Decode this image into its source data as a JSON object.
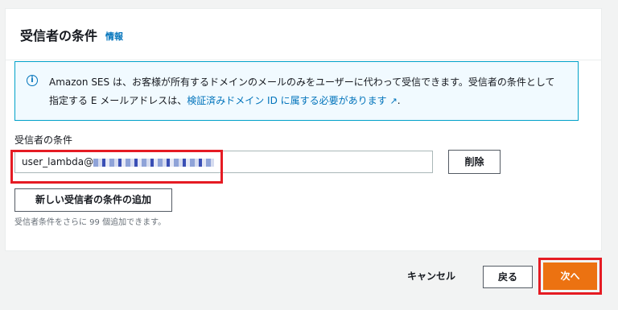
{
  "panel": {
    "title": "受信者の条件",
    "info_link": "情報"
  },
  "alert": {
    "icon": "info-icon",
    "text": "Amazon SES は、お客様が所有するドメインのメールのみをユーザーに代わって受信できます。受信者の条件として指定する E メールアドレスは、",
    "link_text": "検証済みドメイン ID に属する必要があります",
    "suffix": "."
  },
  "condition": {
    "label": "受信者の条件",
    "value": "user_lambda@",
    "delete_label": "削除",
    "add_label": "新しい受信者の条件の追加",
    "hint": "受信者条件をさらに 99 個追加できます。"
  },
  "footer": {
    "cancel_label": "キャンセル",
    "back_label": "戻る",
    "next_label": "次へ"
  },
  "colors": {
    "accent": "#ec7211",
    "link": "#0073bb",
    "highlight": "#e51b23"
  }
}
